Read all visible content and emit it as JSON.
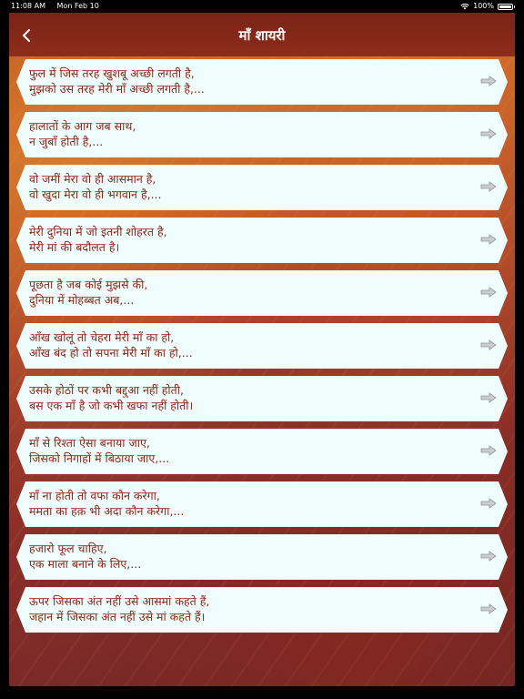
{
  "status": {
    "time": "11:08 AM",
    "date": "Mon Feb 10",
    "battery": "100%"
  },
  "nav": {
    "title": "माँ शायरी",
    "back_icon": "chevron-left-icon"
  },
  "colors": {
    "card_bg": "#f0fdfd",
    "card_text": "#8a2415",
    "nav_bg": "#8d2c1a"
  },
  "items": [
    {
      "line1": "फुल में जिस तरह खुशबू अच्छी लगती है,",
      "line2": "मुझको उस तरह मेरी माँ अच्छी लगती है,..."
    },
    {
      "line1": "हालातों के आग जब साथ,",
      "line2": "न जुबाँ होती है,..."
    },
    {
      "line1": "वो जमीं मेरा वो ही आसमान है,",
      "line2": "वो खुदा मेरा वो ही भगवान है,..."
    },
    {
      "line1": "मेरी दुनिया में जो इतनी शोहरत है,",
      "line2": "मेरी मां की बदौलत है।"
    },
    {
      "line1": "पूछता है जब कोई मुझसे की,",
      "line2": "दुनिया में मोहब्बत अब,..."
    },
    {
      "line1": "आँख खोलूं तो चेहरा मेरी माँ का हो,",
      "line2": "आँख बंद हो तो सपना मेरी माँ का हो,..."
    },
    {
      "line1": "उसके होठों पर कभी बद्दुआ नहीं होती,",
      "line2": "बस एक माँ है जो कभी खफा नहीं होती।"
    },
    {
      "line1": "माँ से रिश्ता ऐसा बनाया जाए,",
      "line2": "जिसको निगाहों में बिठाया जाए,..."
    },
    {
      "line1": "माँ ना होती तो वफा कौन करेगा,",
      "line2": "ममता का हक़ भी अदा कौन करेगा,..."
    },
    {
      "line1": "हजारो फूल चाहिए,",
      "line2": "एक माला बनाने के लिए,..."
    },
    {
      "line1": "ऊपर जिसका अंत नहीं उसे आसमां कहते हैं,",
      "line2": "जहान में जिसका अंत नहीं उसे मां कहते हैं।"
    }
  ]
}
